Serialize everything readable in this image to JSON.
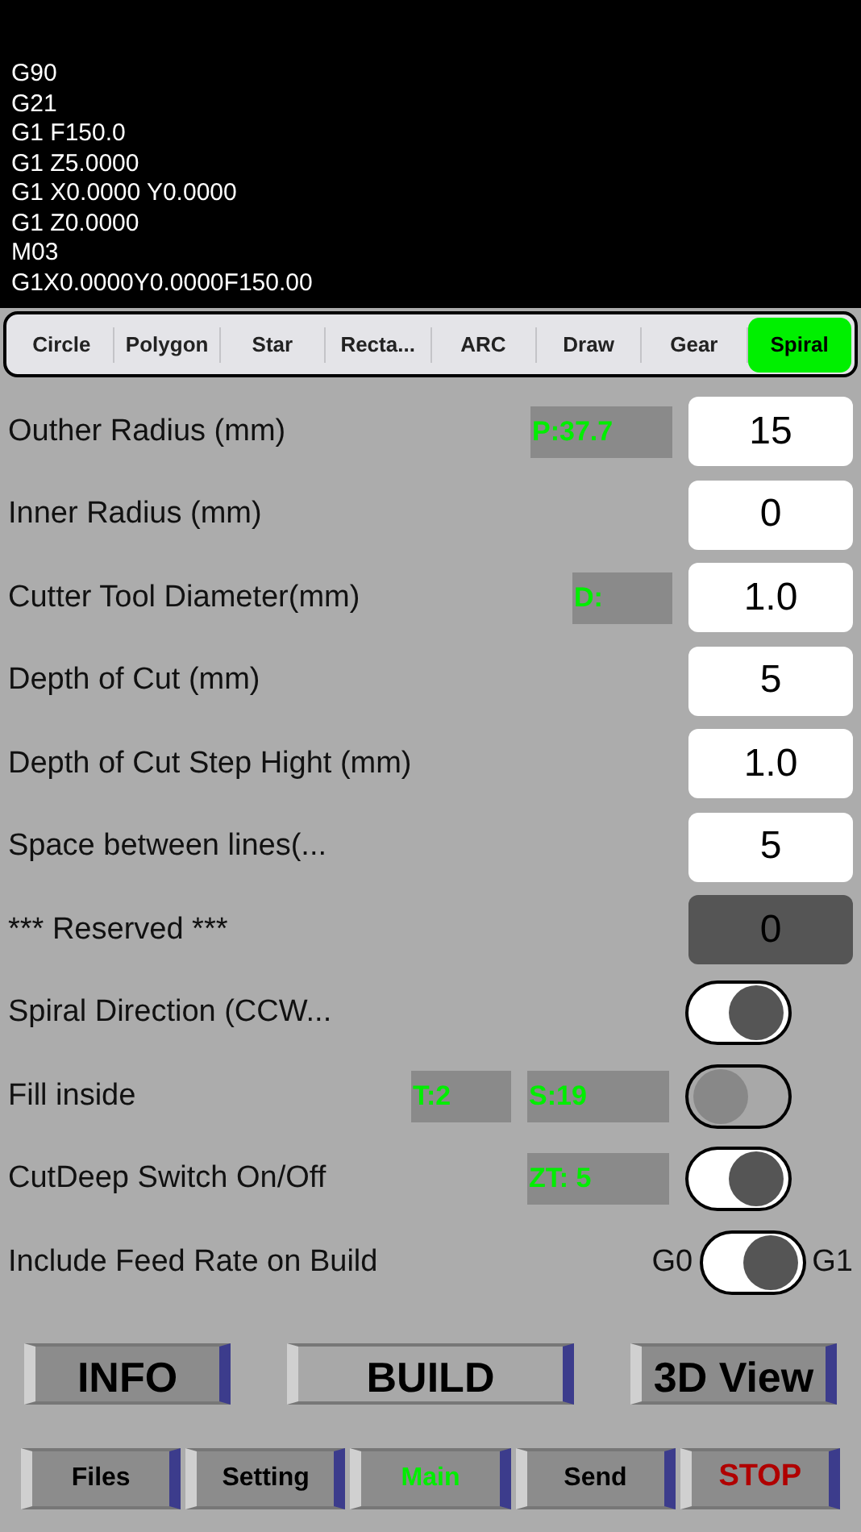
{
  "console": {
    "lines": [
      "G90",
      "G21",
      "G1 F150.0",
      "G1 Z5.0000",
      "G1 X0.0000 Y0.0000",
      "G1 Z0.0000",
      "M03",
      "G1X0.0000Y0.0000F150.00"
    ]
  },
  "shape_tabs": [
    {
      "label": "Circle",
      "selected": false
    },
    {
      "label": "Polygon",
      "selected": false
    },
    {
      "label": "Star",
      "selected": false
    },
    {
      "label": "Recta...",
      "selected": false
    },
    {
      "label": "ARC",
      "selected": false
    },
    {
      "label": "Draw",
      "selected": false
    },
    {
      "label": "Gear",
      "selected": false
    },
    {
      "label": "Spiral",
      "selected": true
    }
  ],
  "settings": [
    {
      "kind": "number",
      "label": "Outher Radius (mm)",
      "badges": [
        "P:37.7"
      ],
      "value": "15",
      "disabled": false
    },
    {
      "kind": "number",
      "label": "Inner Radius (mm)",
      "value": "0",
      "disabled": false
    },
    {
      "kind": "number",
      "label": "Cutter Tool Diameter(mm)",
      "badges": [
        "D:"
      ],
      "value": "1.0",
      "disabled": false
    },
    {
      "kind": "number",
      "label": "Depth of Cut (mm)",
      "value": "5",
      "disabled": false
    },
    {
      "kind": "number",
      "label": "Depth of Cut Step Hight (mm)",
      "value": "1.0",
      "disabled": false
    },
    {
      "kind": "number",
      "label": "Space between lines(...",
      "value": "5",
      "disabled": false
    },
    {
      "kind": "number",
      "label": "*** Reserved ***",
      "value": "0",
      "disabled": true
    },
    {
      "kind": "switch",
      "label": "Spiral Direction (CCW...",
      "on": true
    },
    {
      "kind": "switch",
      "label": "Fill inside",
      "badges": [
        "T:2",
        "S:19"
      ],
      "on": false
    },
    {
      "kind": "switch",
      "label": "CutDeep Switch On/Off",
      "badges": [
        "ZT: 5"
      ],
      "on": true
    },
    {
      "kind": "switch",
      "label": "Include Feed Rate on Build",
      "left_label": "G0",
      "right_label": "G1",
      "on": true
    }
  ],
  "actions": [
    "INFO",
    "BUILD",
    "3D View"
  ],
  "nav": [
    {
      "label": "Files",
      "kind": "normal",
      "selected": false
    },
    {
      "label": "Setting",
      "kind": "normal",
      "selected": false
    },
    {
      "label": "Main",
      "kind": "normal",
      "selected": true
    },
    {
      "label": "Send",
      "kind": "normal",
      "selected": false
    },
    {
      "label": "STOP",
      "kind": "stop",
      "selected": false
    }
  ]
}
